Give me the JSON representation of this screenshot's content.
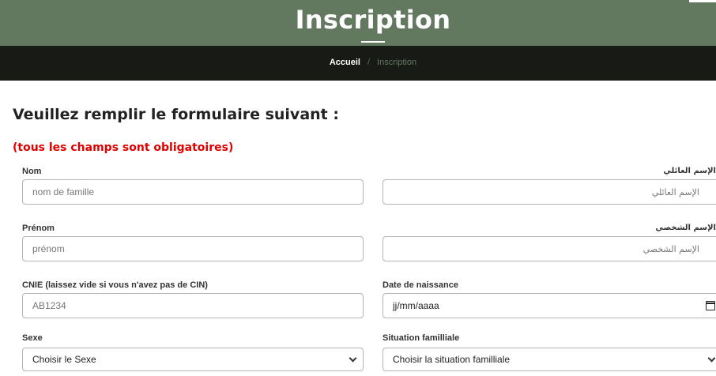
{
  "header": {
    "title": "Inscription",
    "breadcrumb": {
      "home": "Accueil",
      "separator": "/",
      "current": "Inscription"
    },
    "colors": {
      "hero": "#627960",
      "bar": "#171a15"
    }
  },
  "form": {
    "heading": "Veuillez remplir le formulaire suivant :",
    "required_note": "(tous les champs sont obligatoires)",
    "nom": {
      "label": "Nom",
      "placeholder": "nom de famille"
    },
    "nom_ar": {
      "label": "الإسم العائلي",
      "placeholder": "الإسم العائلي"
    },
    "prenom": {
      "label": "Prénom",
      "placeholder": "prénom"
    },
    "prenom_ar": {
      "label": "الإسم الشخصي",
      "placeholder": "الإسم الشخصي"
    },
    "cnie": {
      "label": "CNIE (laissez vide si vous n'avez pas de CIN)",
      "placeholder": "AB1234"
    },
    "naissance": {
      "label": "Date de naissance",
      "value": "jj/mm/aaaa"
    },
    "sexe": {
      "label": "Sexe",
      "selected": "Choisir le Sexe"
    },
    "situation": {
      "label": "Situation familliale",
      "selected": "Choisir la situation familliale"
    }
  },
  "icons": {
    "date": "calendar-icon",
    "select": "chevron-down-icon"
  }
}
